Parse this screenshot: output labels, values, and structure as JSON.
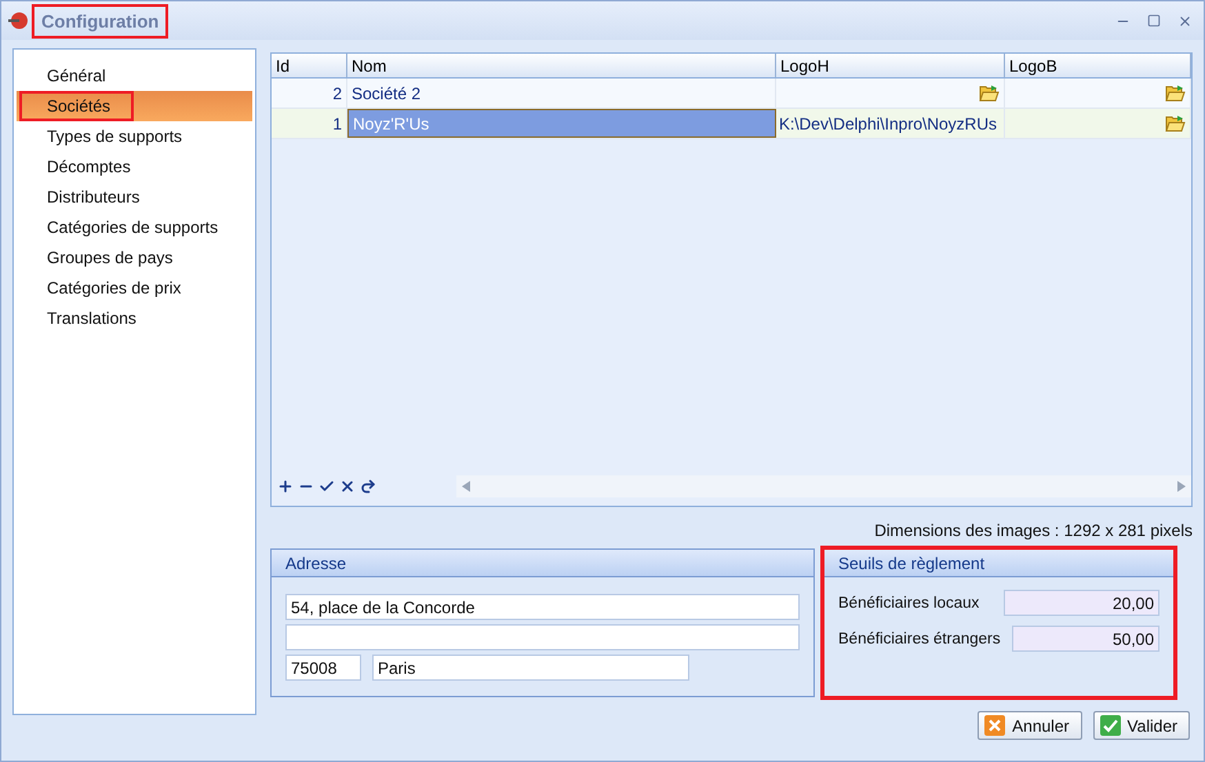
{
  "window": {
    "title": "Configuration",
    "highlighted": true
  },
  "sidebar": {
    "items": [
      {
        "label": "Général",
        "selected": false,
        "highlighted": false
      },
      {
        "label": "Sociétés",
        "selected": true,
        "highlighted": true
      },
      {
        "label": "Types de supports",
        "selected": false,
        "highlighted": false
      },
      {
        "label": "Décomptes",
        "selected": false,
        "highlighted": false
      },
      {
        "label": "Distributeurs",
        "selected": false,
        "highlighted": false
      },
      {
        "label": "Catégories de supports",
        "selected": false,
        "highlighted": false
      },
      {
        "label": "Groupes de pays",
        "selected": false,
        "highlighted": false
      },
      {
        "label": "Catégories de prix",
        "selected": false,
        "highlighted": false
      },
      {
        "label": "Translations",
        "selected": false,
        "highlighted": false
      }
    ]
  },
  "table": {
    "columns": [
      "Id",
      "Nom",
      "LogoH",
      "LogoB"
    ],
    "rows": [
      {
        "id": "2",
        "nom": "Société 2",
        "logo_h": null,
        "selected": false
      },
      {
        "id": "1",
        "nom": "Noyz'R'Us",
        "logo_h": "K:\\Dev\\Delphi\\Inpro\\NoyzRUs",
        "selected": true
      }
    ]
  },
  "image_dimensions": "Dimensions des images : 1292 x 281 pixels",
  "address": {
    "title": "Adresse",
    "line1": "54, place de la Concorde",
    "postcode": "75008",
    "city": "Paris"
  },
  "thresholds": {
    "title": "Seuils de règlement",
    "highlighted": true,
    "fields": [
      {
        "label": "Bénéficiaires locaux",
        "value": "20,00"
      },
      {
        "label": "Bénéficiaires étrangers",
        "value": "50,00"
      }
    ]
  },
  "buttons": [
    {
      "label": "Annuler",
      "kind": "cancel"
    },
    {
      "label": "Valider",
      "kind": "ok"
    }
  ]
}
